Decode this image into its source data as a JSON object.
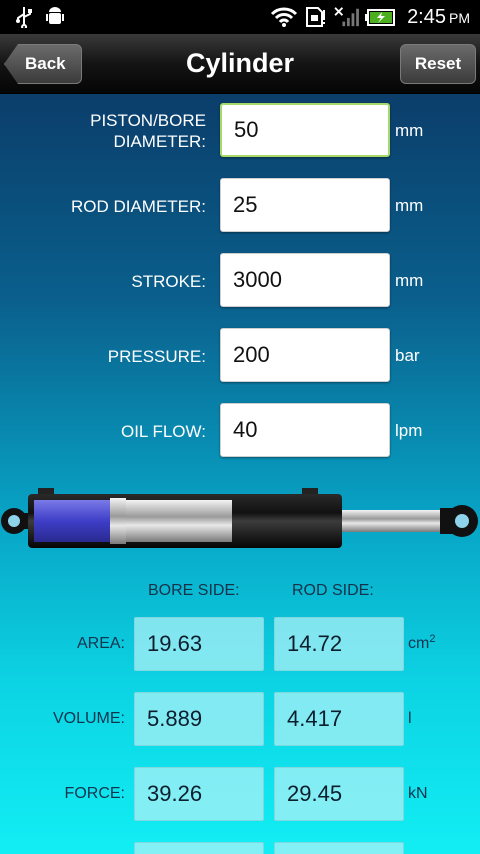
{
  "status_bar": {
    "time": "2:45",
    "ampm": "PM",
    "icons": [
      "usb-icon",
      "android-debug-icon",
      "wifi-icon",
      "sd-card-icon",
      "no-signal-icon",
      "battery-charging-icon"
    ]
  },
  "header": {
    "title": "Cylinder",
    "back_label": "Back",
    "reset_label": "Reset"
  },
  "inputs": [
    {
      "label": "PISTON/BORE\nDIAMETER:",
      "value": "50",
      "unit": "mm"
    },
    {
      "label": "ROD DIAMETER:",
      "value": "25",
      "unit": "mm"
    },
    {
      "label": "STROKE:",
      "value": "3000",
      "unit": "mm"
    },
    {
      "label": "PRESSURE:",
      "value": "200",
      "unit": "bar"
    },
    {
      "label": "OIL FLOW:",
      "value": "40",
      "unit": "lpm"
    }
  ],
  "results": {
    "bore_header": "BORE SIDE:",
    "rod_header": "ROD SIDE:",
    "rows": [
      {
        "label": "AREA:",
        "bore": "19.63",
        "rod": "14.72",
        "unit": "cm",
        "unit_sup": "2"
      },
      {
        "label": "VOLUME:",
        "bore": "5.889",
        "rod": "4.417",
        "unit": "l",
        "unit_sup": ""
      },
      {
        "label": "FORCE:",
        "bore": "39.26",
        "rod": "29.45",
        "unit": "kN",
        "unit_sup": ""
      }
    ]
  },
  "colors": {
    "piston": "#4a4ad0",
    "barrel": "#1a1a1a",
    "rod": "#d0d0d0"
  }
}
